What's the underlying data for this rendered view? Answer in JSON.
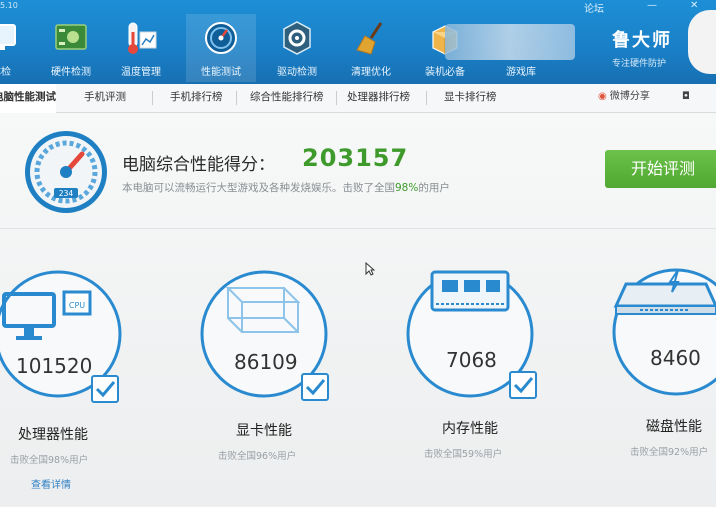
{
  "window": {
    "title": "5.10"
  },
  "toolbar": {
    "items": [
      {
        "label": "体检",
        "icon": "monitor-icon"
      },
      {
        "label": "硬件检测",
        "icon": "circuit-board-icon"
      },
      {
        "label": "温度管理",
        "icon": "thermometer-icon"
      },
      {
        "label": "性能测试",
        "icon": "speedometer-icon",
        "active": true
      },
      {
        "label": "驱动检测",
        "icon": "gear-icon"
      },
      {
        "label": "清理优化",
        "icon": "broom-icon"
      },
      {
        "label": "装机必备",
        "icon": "box-icon"
      },
      {
        "label": "游戏库",
        "icon": "gamepad-icon"
      }
    ],
    "window_controls": {
      "forum": "论坛",
      "minimize": "—",
      "close": "✕"
    }
  },
  "brand": {
    "name": "鲁大师",
    "tagline": "专注硬件防护"
  },
  "subnav": {
    "tabs": [
      {
        "label": "电脑性能测试",
        "active": true
      },
      {
        "label": "手机评测"
      },
      {
        "label": "手机排行榜"
      },
      {
        "label": "综合性能排行榜"
      },
      {
        "label": "处理器排行榜"
      },
      {
        "label": "显卡排行榜"
      }
    ],
    "share_label": "微博分享"
  },
  "score": {
    "title": "电脑综合性能得分：",
    "value": "203157",
    "desc_prefix": "本电脑可以流畅运行大型游戏及各种发烧娱乐。击败了全国",
    "desc_pct": "98%",
    "desc_suffix": "的用户",
    "gauge_text": "234",
    "start_button": "开始评测"
  },
  "cards": [
    {
      "name": "处理器性能",
      "value": "101520",
      "beat": "击败全国98%用户",
      "icon": "cpu-monitor-icon",
      "checked": true
    },
    {
      "name": "显卡性能",
      "value": "86109",
      "beat": "击败全国96%用户",
      "icon": "graphics-cube-icon",
      "checked": true
    },
    {
      "name": "内存性能",
      "value": "7068",
      "beat": "击败全国59%用户",
      "icon": "memory-chip-icon",
      "checked": true
    },
    {
      "name": "磁盘性能",
      "value": "8460",
      "beat": "击败全国92%用户",
      "icon": "hard-disk-icon",
      "checked": false
    }
  ],
  "detail_link": "查看详情",
  "colors": {
    "accent": "#1a84cc",
    "score_green": "#3f9a2c",
    "ring": "#2a8ad0",
    "button": "#5bb53c"
  }
}
